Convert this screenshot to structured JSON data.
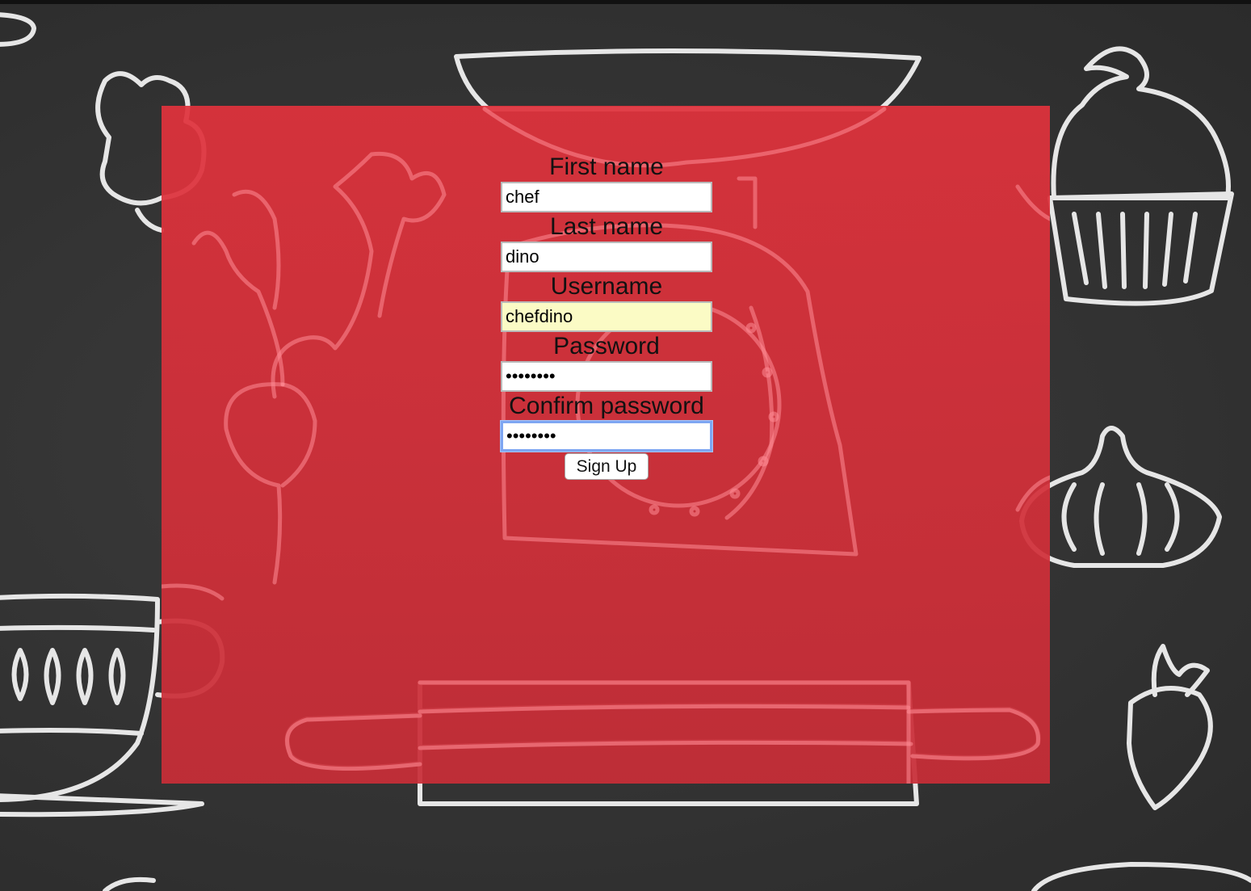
{
  "signup_form": {
    "first_name": {
      "label": "First name",
      "value": "chef"
    },
    "last_name": {
      "label": "Last name",
      "value": "dino"
    },
    "username": {
      "label": "Username",
      "value": "chefdino"
    },
    "password": {
      "label": "Password",
      "value": "password"
    },
    "confirm_password": {
      "label": "Confirm password",
      "value": "password"
    },
    "submit_label": "Sign Up"
  },
  "theme": {
    "panel_color": "#d9363e",
    "background_color": "#333333",
    "autofill_color": "#fbfbc5",
    "focus_color": "#7ea6f2"
  },
  "background_icons": [
    "bowl-icon",
    "cupcake-icon",
    "radish-icon",
    "kitchen-scale-icon",
    "teacup-icon",
    "rolling-pin-icon",
    "garlic-icon",
    "strawberry-icon"
  ]
}
